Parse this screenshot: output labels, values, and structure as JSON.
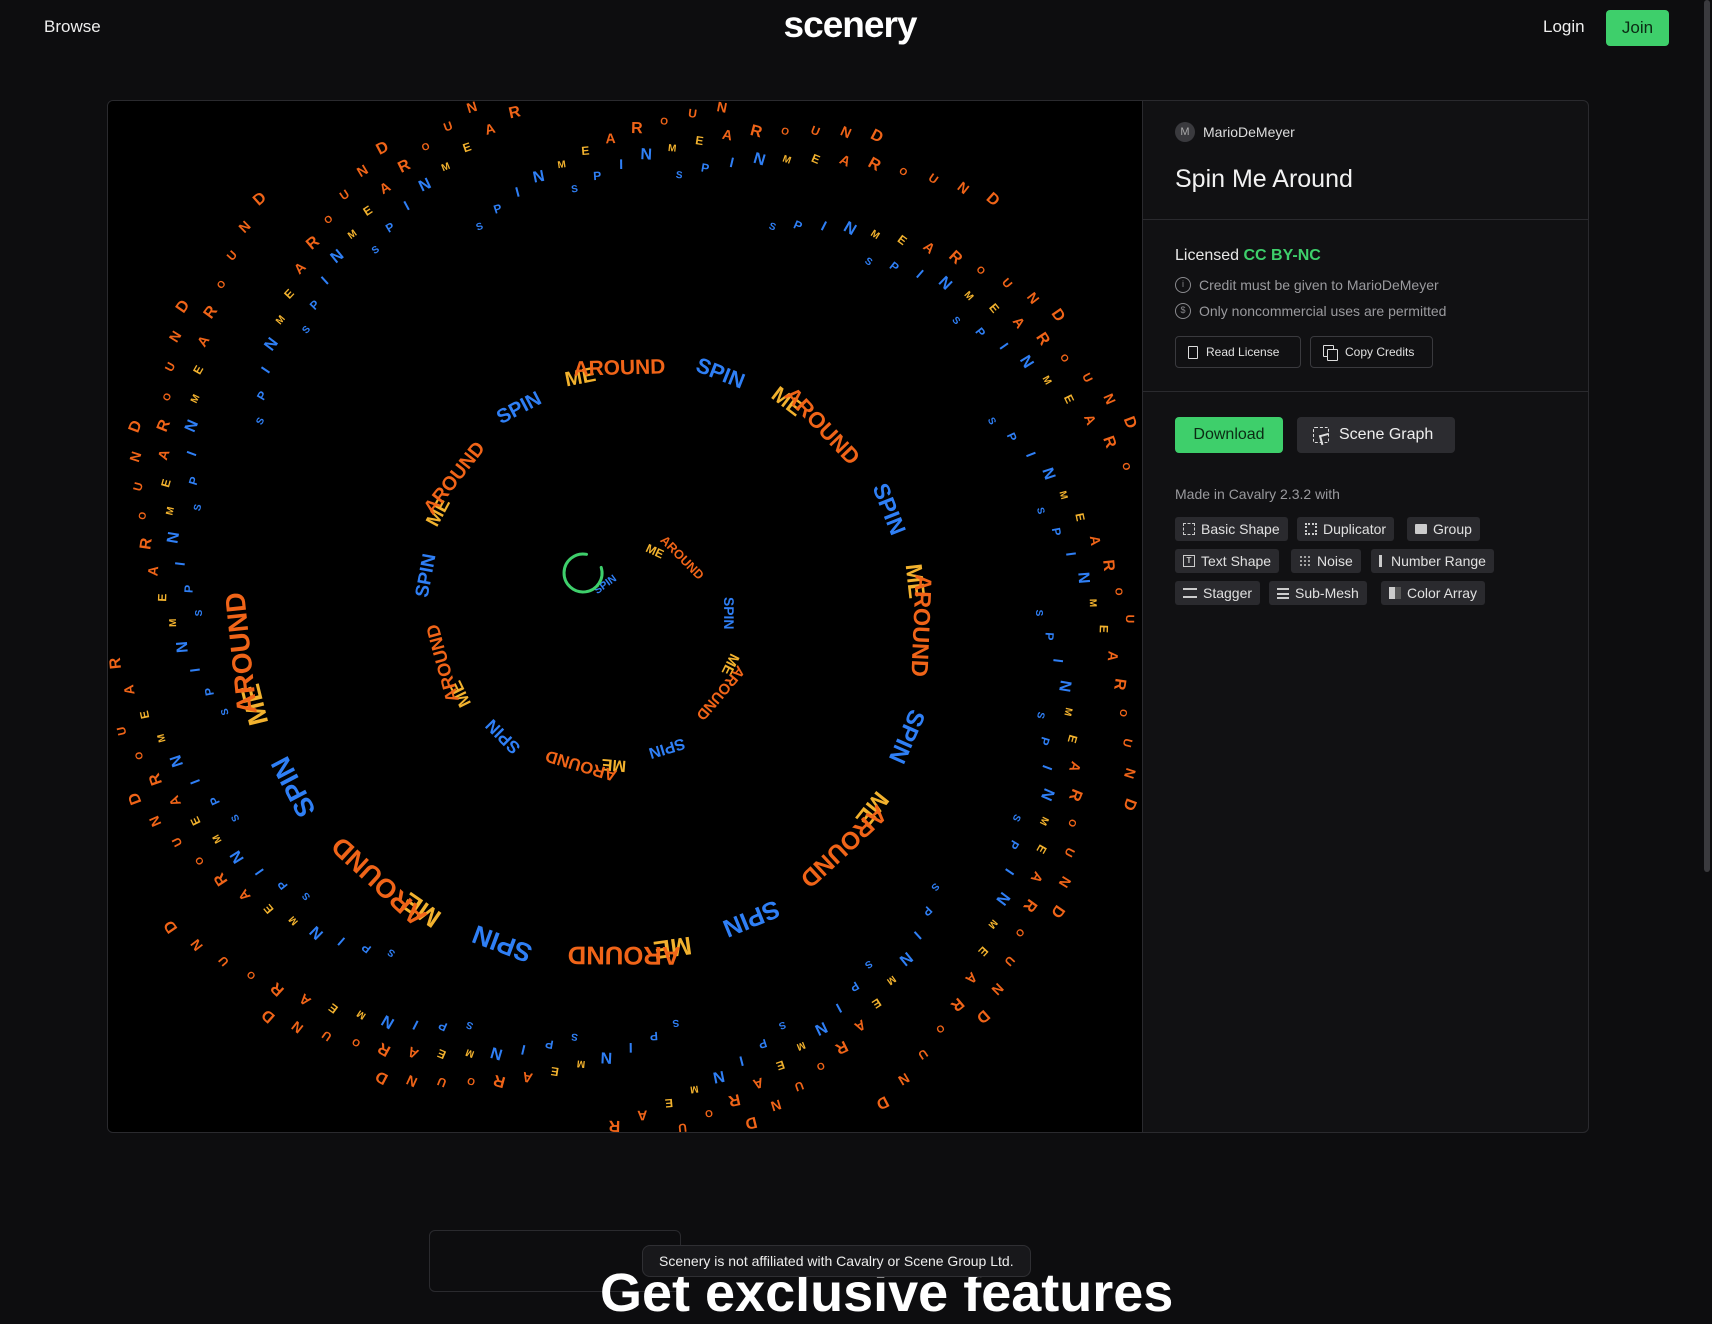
{
  "nav": {
    "browse": "Browse",
    "logo": "scenery",
    "login": "Login",
    "join": "Join"
  },
  "artwork": {
    "words": [
      "SPIN",
      "ME",
      "AROUND"
    ],
    "letters": [
      "S",
      "P",
      "I",
      "N",
      "M",
      "E",
      "A",
      "R",
      "O",
      "U",
      "N",
      "D"
    ],
    "colors": {
      "spin": "#2f7ff5",
      "me": "#f2b22e",
      "around": "#f06418",
      "spinner": "#3ecf6b",
      "background": "#000000"
    }
  },
  "details": {
    "author": {
      "name": "MarioDeMeyer",
      "initial": "M"
    },
    "title": "Spin Me Around",
    "license": {
      "prefix": "Licensed",
      "name": "CC BY-NC",
      "credit": "Credit must be given to MarioDeMeyer",
      "noncommercial": "Only noncommercial uses are permitted",
      "read_label": "Read License",
      "copy_label": "Copy Credits"
    },
    "download_label": "Download",
    "scene_graph_label": "Scene Graph",
    "made_in": "Made in Cavalry 2.3.2 with",
    "tools": [
      {
        "label": "Basic Shape",
        "icon": "basic-shape-icon"
      },
      {
        "label": "Duplicator",
        "icon": "duplicator-icon"
      },
      {
        "label": "Group",
        "icon": "folder-icon"
      },
      {
        "label": "Text Shape",
        "icon": "text-shape-icon"
      },
      {
        "label": "Noise",
        "icon": "noise-icon"
      },
      {
        "label": "Number Range",
        "icon": "number-range-icon"
      },
      {
        "label": "Stagger",
        "icon": "stagger-icon"
      },
      {
        "label": "Sub-Mesh",
        "icon": "sub-mesh-icon"
      },
      {
        "label": "Color Array",
        "icon": "color-array-icon"
      }
    ]
  },
  "footer": {
    "notice": "Scenery is not affiliated with Cavalry or Scene Group Ltd.",
    "heading": "Get exclusive features"
  }
}
